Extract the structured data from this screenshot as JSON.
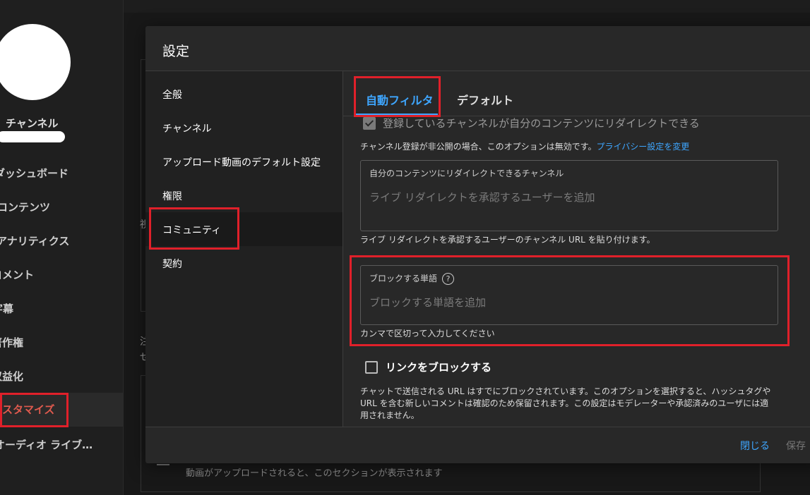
{
  "background": {
    "sidebar": {
      "channel_label": "チャンネル",
      "items": [
        {
          "label": "ダッシュボード"
        },
        {
          "label": "コンテンツ"
        },
        {
          "label": "アナリティクス"
        },
        {
          "label": "コメント"
        },
        {
          "label": "字幕"
        },
        {
          "label": "著作権"
        },
        {
          "label": "収益化"
        },
        {
          "label": "カスタマイズ"
        },
        {
          "label": "オーディオ ライブ…"
        }
      ]
    },
    "fragments": [
      "視",
      "注",
      "せ"
    ],
    "upload_hint": "動画がアップロードされると、このセクションが表示されます"
  },
  "modal": {
    "title": "設定",
    "nav": [
      {
        "label": "全般"
      },
      {
        "label": "チャンネル"
      },
      {
        "label": "アップロード動画のデフォルト設定"
      },
      {
        "label": "権限"
      },
      {
        "label": "コミュニティ"
      },
      {
        "label": "契約"
      }
    ],
    "tabs": [
      {
        "label": "自動フィルタ"
      },
      {
        "label": "デフォルト"
      }
    ],
    "content": {
      "redirect_checkbox_label": "登録しているチャンネルが自分のコンテンツにリダイレクトできる",
      "redirect_note": "チャンネル登録が非公開の場合、このオプションは無効です。",
      "privacy_link": "プライバシー設定を変更",
      "redirect_field_label": "自分のコンテンツにリダイレクトできるチャンネル",
      "redirect_field_placeholder": "ライブ リダイレクトを承認するユーザーを追加",
      "redirect_field_help": "ライブ リダイレクトを承認するユーザーのチャンネル URL を貼り付けます。",
      "blocked_words_label": "ブロックする単語",
      "help_icon_glyph": "?",
      "blocked_words_placeholder": "ブロックする単語を追加",
      "blocked_words_help": "カンマで区切って入力してください",
      "block_links_label": "リンクをブロックする",
      "block_links_desc_1": "チャットで送信される URL はすでにブロックされています。このオプションを選択すると、ハッシュタグや",
      "block_links_desc_2": "URL を含む新しいコメントは確認のため保留されます。この設定はモデレーターや承認済みのユーザには適",
      "block_links_desc_3": "用されません。"
    },
    "footer": {
      "close_label": "閉じる",
      "save_label": "保存"
    }
  },
  "colors": {
    "accent": "#3ea6ff",
    "highlight": "#e0202a",
    "active_nav": "#e05a4e"
  }
}
